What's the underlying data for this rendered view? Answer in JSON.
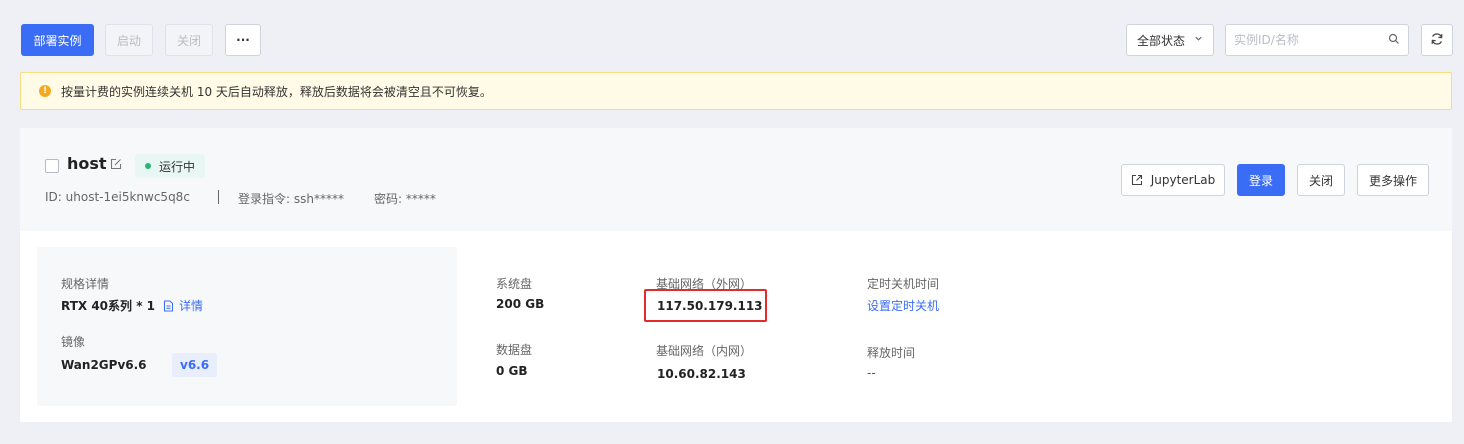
{
  "toolbar": {
    "deploy_label": "部署实例",
    "start_label": "启动",
    "close_label": "关闭",
    "more_label": "···",
    "status_filter": "全部状态",
    "search_placeholder": "实例ID/名称"
  },
  "notice": {
    "text": "按量计费的实例连续关机 10 天后自动释放，释放后数据将会被清空且不可恢复。"
  },
  "instance": {
    "name": "host",
    "status": "运行中",
    "id_text": "ID: uhost-1ei5knwc5q8c",
    "login_cmd_text": "登录指令: ssh*****",
    "password_text": "密码: *****",
    "actions": {
      "jupyter_label": "JupyterLab",
      "login_label": "登录",
      "close_label": "关闭",
      "more_label": "更多操作"
    },
    "spec": {
      "spec_label": "规格详情",
      "spec_value": "RTX 40系列 * 1",
      "detail_link": "详情",
      "image_label": "镜像",
      "image_value": "Wan2GPv6.6",
      "image_version": "v6.6"
    },
    "disk": {
      "system_label": "系统盘",
      "system_value": "200 GB",
      "data_label": "数据盘",
      "data_value": "0 GB"
    },
    "network": {
      "public_label": "基础网络（外网）",
      "public_ip": "117.50.179.113",
      "private_label": "基础网络（内网）",
      "private_ip": "10.60.82.143"
    },
    "schedule": {
      "shutdown_label": "定时关机时间",
      "shutdown_link": "设置定时关机",
      "release_label": "释放时间",
      "release_value": "--"
    }
  },
  "colors": {
    "primary": "#3b6cf6",
    "running": "#2bb673",
    "warning": "#f4a922",
    "highlight": "#e22c2c"
  }
}
